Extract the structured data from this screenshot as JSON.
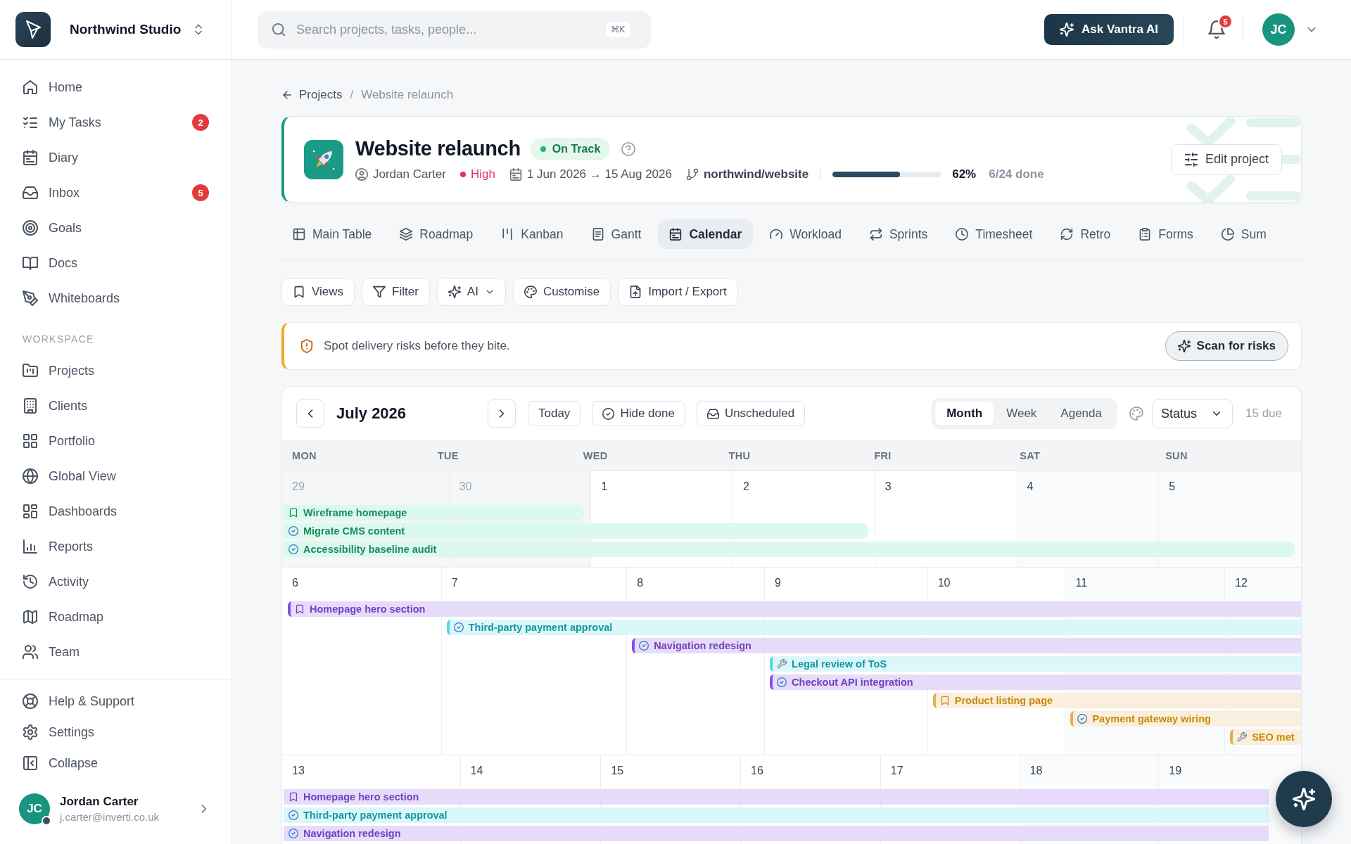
{
  "sidebar": {
    "workspace_name": "Northwind Studio",
    "main_nav": [
      {
        "label": "Home",
        "selected": false
      },
      {
        "label": "My Tasks",
        "selected": false,
        "badge": "2"
      },
      {
        "label": "Diary",
        "selected": false
      },
      {
        "label": "Inbox",
        "selected": false,
        "badge": "5"
      },
      {
        "label": "Goals",
        "selected": false
      },
      {
        "label": "Docs",
        "selected": false
      },
      {
        "label": "Whiteboards",
        "selected": false
      }
    ],
    "section_label": "WORKSPACE",
    "workspace_nav": [
      {
        "label": "Projects",
        "selected": false
      },
      {
        "label": "Clients",
        "selected": false
      },
      {
        "label": "Portfolio",
        "selected": false
      },
      {
        "label": "Global View",
        "selected": false
      },
      {
        "label": "Dashboards",
        "selected": false
      },
      {
        "label": "Reports",
        "selected": false
      },
      {
        "label": "Activity",
        "selected": false
      },
      {
        "label": "Roadmap",
        "selected": false
      },
      {
        "label": "Team",
        "selected": false
      }
    ],
    "footer_nav": [
      {
        "label": "Help & Support"
      },
      {
        "label": "Settings"
      },
      {
        "label": "Collapse"
      }
    ],
    "user": {
      "initials": "JC",
      "name": "Jordan Carter",
      "email": "j.carter@inverti.co.uk"
    }
  },
  "header": {
    "search": {
      "placeholder": "Search projects, tasks, people...",
      "shortcut": "⌘K"
    },
    "ai_button": "Ask Vantra AI",
    "notification_count": "5",
    "avatar_initials": "JC"
  },
  "breadcrumb": {
    "parent": "Projects",
    "separator": "/",
    "current": "Website relaunch"
  },
  "project": {
    "title": "Website relaunch",
    "status": "On Track",
    "owner": "Jordan Carter",
    "priority": "High",
    "dates": "1 Jun 2026 → 15 Aug 2026",
    "repository": "northwind/website",
    "progress": {
      "level": 0.62,
      "percent": "62%",
      "count": "6/24 done"
    },
    "edit_button": "Edit project"
  },
  "tabs": [
    {
      "label": "Main Table",
      "selected": false
    },
    {
      "label": "Roadmap",
      "selected": false
    },
    {
      "label": "Kanban",
      "selected": false
    },
    {
      "label": "Gantt",
      "selected": false
    },
    {
      "label": "Calendar",
      "selected": true
    },
    {
      "label": "Workload",
      "selected": false
    },
    {
      "label": "Sprints",
      "selected": false
    },
    {
      "label": "Timesheet",
      "selected": false
    },
    {
      "label": "Retro",
      "selected": false
    },
    {
      "label": "Forms",
      "selected": false
    },
    {
      "label": "Sum",
      "selected": false
    }
  ],
  "toolbar": [
    {
      "label": "Views",
      "dropdown": false
    },
    {
      "label": "Filter",
      "dropdown": false
    },
    {
      "label": "AI",
      "dropdown": true
    },
    {
      "label": "Customise",
      "dropdown": false
    },
    {
      "label": "Import / Export",
      "dropdown": false
    }
  ],
  "risk_banner": {
    "message": "Spot delivery risks before they bite.",
    "button": "Scan for risks"
  },
  "calendar": {
    "month_title": "July 2026",
    "today_button": "Today",
    "hide_done_button": "Hide done",
    "unscheduled_button": "Unscheduled",
    "view_modes": [
      {
        "label": "Month",
        "selected": true
      },
      {
        "label": "Week",
        "selected": false
      },
      {
        "label": "Agenda",
        "selected": false
      }
    ],
    "group_by": "Status",
    "due_count": "15 due",
    "weekdays": [
      "MON",
      "TUE",
      "WED",
      "THU",
      "FRI",
      "SAT",
      "SUN"
    ],
    "weeks": [
      {
        "days": [
          {
            "label": "29",
            "outside_month": true
          },
          {
            "label": "30",
            "outside_month": true,
            "events": [
              {
                "title": "Wireframe homepage",
                "kind": "milestone",
                "color": "#1a8a5c",
                "continued": true,
                "continues": false
              }
            ]
          },
          {
            "label": "1",
            "outside_month": false
          },
          {
            "label": "2",
            "outside_month": false,
            "events": [
              {
                "title": "Migrate CMS content",
                "kind": "task",
                "color": "#1a8a5c",
                "continued": true,
                "continues": false
              }
            ]
          },
          {
            "label": "3",
            "outside_month": false
          },
          {
            "label": "4",
            "outside_month": false
          },
          {
            "label": "5",
            "outside_month": false,
            "events": [
              {
                "title": "Accessibility baseline audit",
                "kind": "task",
                "color": "#1a8a5c",
                "continued": true,
                "continues": false
              }
            ]
          }
        ]
      },
      {
        "days": [
          {
            "label": "6",
            "outside_month": false,
            "events": [
              {
                "title": "Homepage hero section",
                "kind": "milestone",
                "color": "#6f42c1",
                "continued": false,
                "continues": true
              }
            ]
          },
          {
            "label": "7",
            "outside_month": false,
            "events": [
              {
                "title": "Third-party payment approval",
                "kind": "task",
                "color": "#0f99a3",
                "continued": false,
                "continues": true
              }
            ]
          },
          {
            "label": "8",
            "outside_month": false,
            "events": [
              {
                "title": "Navigation redesign",
                "kind": "task",
                "color": "#6f42c1",
                "continued": false,
                "continues": true
              }
            ]
          },
          {
            "label": "9",
            "outside_month": false,
            "events": [
              {
                "title": "Legal review of ToS",
                "kind": "review",
                "color": "#0f99a3",
                "continued": false,
                "continues": true
              },
              {
                "title": "Checkout API integration",
                "kind": "task",
                "color": "#6f42c1",
                "continued": false,
                "continues": true
              }
            ]
          },
          {
            "label": "10",
            "outside_month": false,
            "events": [
              {
                "title": "Product listing page",
                "kind": "milestone",
                "color": "#c98a0b",
                "continued": false,
                "continues": true
              }
            ]
          },
          {
            "label": "11",
            "outside_month": false,
            "events": [
              {
                "title": "Payment gateway wiring",
                "kind": "task",
                "color": "#c98a0b",
                "continued": false,
                "continues": true
              }
            ]
          },
          {
            "label": "12",
            "outside_month": false,
            "events": [
              {
                "title": "SEO met",
                "kind": "review",
                "color": "#c98a0b",
                "continued": false,
                "continues": true
              }
            ]
          }
        ]
      },
      {
        "days": [
          {
            "label": "13",
            "outside_month": false,
            "events": [
              {
                "title": "Homepage hero section",
                "kind": "milestone",
                "color": "#6f42c1",
                "continued": true,
                "continues": true
              },
              {
                "title": "Third-party payment approval",
                "kind": "task",
                "color": "#0f99a3",
                "continued": true,
                "continues": true
              },
              {
                "title": "Navigation redesign",
                "kind": "task",
                "color": "#6f42c1",
                "continued": true,
                "continues": true
              }
            ]
          },
          {
            "label": "14",
            "outside_month": false
          },
          {
            "label": "15",
            "outside_month": false
          },
          {
            "label": "16",
            "outside_month": false
          },
          {
            "label": "17",
            "outside_month": false
          },
          {
            "label": "18",
            "outside_month": false
          },
          {
            "label": "19",
            "outside_month": false
          }
        ]
      }
    ]
  }
}
